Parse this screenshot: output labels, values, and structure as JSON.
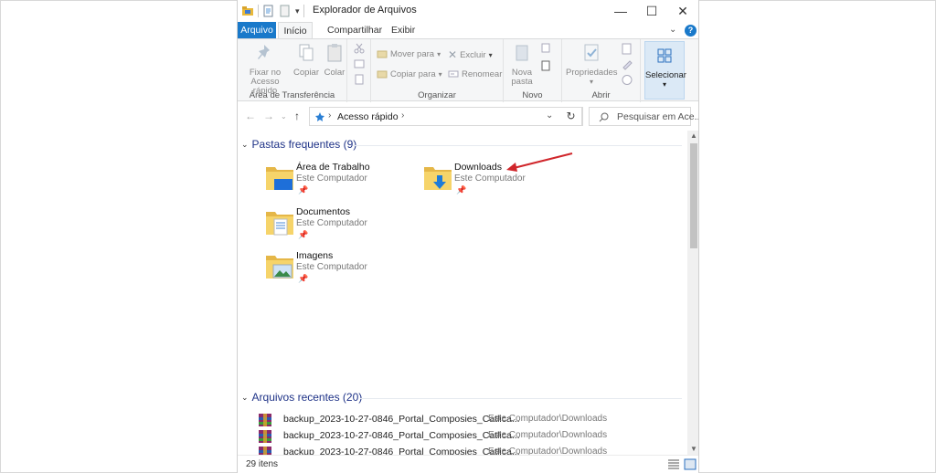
{
  "window": {
    "title": "Explorador de Arquivos",
    "controls": {
      "minimize": "—",
      "maximize": "☐",
      "close": "✕"
    }
  },
  "tabs": [
    {
      "label": "Arquivo"
    },
    {
      "label": "Início"
    },
    {
      "label": "Compartilhar"
    },
    {
      "label": "Exibir"
    }
  ],
  "ribbon": {
    "groups": {
      "clipboard": "Área de Transferência",
      "organize": "Organizar",
      "new": "Novo",
      "open": "Abrir"
    },
    "pin_label_line1": "Fixar no",
    "pin_label_line2": "Acesso rápido",
    "copy": "Copiar",
    "paste": "Colar",
    "move_to": "Mover para",
    "copy_to": "Copiar para",
    "delete": "Excluir",
    "rename": "Renomear",
    "new_folder_line1": "Nova",
    "new_folder_line2": "pasta",
    "properties": "Propriedades",
    "select": "Selecionar"
  },
  "nav": {
    "address": "Acesso rápido",
    "search_placeholder": "Pesquisar em Ace..."
  },
  "frequent": {
    "header": "Pastas frequentes (9)",
    "items": [
      {
        "name": "Área de Trabalho",
        "location": "Este Computador"
      },
      {
        "name": "Downloads",
        "location": "Este Computador"
      },
      {
        "name": "Documentos",
        "location": "Este Computador"
      },
      {
        "name": "Imagens",
        "location": "Este Computador"
      }
    ]
  },
  "recent": {
    "header": "Arquivos recentes (20)",
    "items": [
      {
        "name": "backup_2023-10-27-0846_Portal_Composies_Catlica...",
        "location": "Este Computador\\Downloads"
      },
      {
        "name": "backup_2023-10-27-0846_Portal_Composies_Catlica...",
        "location": "Este Computador\\Downloads"
      },
      {
        "name": "backup_2023-10-27-0846_Portal_Composies_Catlica...",
        "location": "Este Computador\\Downloads"
      }
    ]
  },
  "status": {
    "count": "29 itens"
  },
  "colors": {
    "accent": "#1979ca",
    "section_header": "#1e3287",
    "annotation_arrow": "#d0262b"
  }
}
